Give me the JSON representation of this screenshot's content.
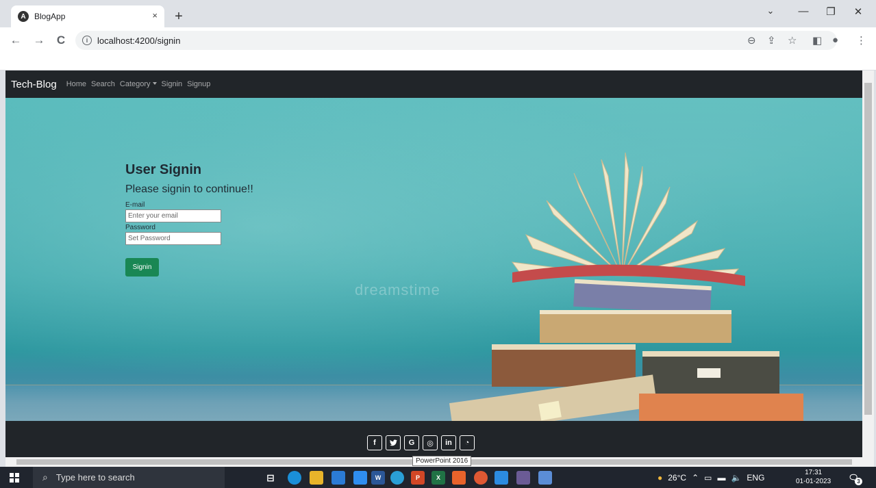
{
  "browser": {
    "tab_title": "BlogApp",
    "tab_close": "×",
    "new_tab": "+",
    "url": "localhost:4200/signin",
    "window_controls": {
      "minimize": "—",
      "restore": "❐",
      "close": "✕",
      "dropdown": "⌄"
    },
    "nav": {
      "back": "←",
      "forward": "→",
      "reload": "C"
    }
  },
  "navbar": {
    "brand": "Tech-Blog",
    "links": [
      "Home",
      "Search",
      "Category",
      "Signin",
      "Signup"
    ]
  },
  "signin": {
    "title": "User Signin",
    "subtitle": "Please signin to continue!!",
    "email_label": "E-mail",
    "email_placeholder": "Enter your email",
    "password_label": "Password",
    "password_placeholder": "Set Password",
    "button_label": "Signin",
    "button_color": "#198754"
  },
  "hero": {
    "watermark": "dreamstime"
  },
  "footer": {
    "social": [
      {
        "icon": "facebook-icon",
        "glyph": "f"
      },
      {
        "icon": "twitter-icon",
        "glyph": "🐦"
      },
      {
        "icon": "google-icon",
        "glyph": "G"
      },
      {
        "icon": "instagram-icon",
        "glyph": "◎"
      },
      {
        "icon": "linkedin-icon",
        "glyph": "in"
      },
      {
        "icon": "github-icon",
        "glyph": "◔"
      }
    ]
  },
  "tooltip": "PowerPoint 2016",
  "taskbar": {
    "search_placeholder": "Type here to search",
    "weather": "26°C",
    "language": "ENG",
    "time": "17:31",
    "date": "01-01-2023",
    "notifications": "3"
  },
  "colors": {
    "navbar_bg": "#212529",
    "accent_green": "#198754",
    "hero_teal": "#3fa9ad"
  }
}
